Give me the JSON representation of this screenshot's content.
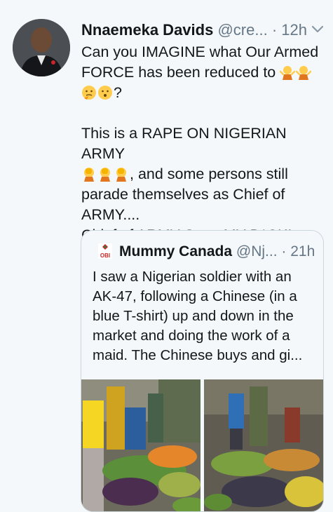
{
  "tweet": {
    "author_name": "Nnaemeka Davids",
    "handle": "@cre...",
    "separator": "·",
    "time": "12h",
    "lines": [
      "Can you IMAGINE what Our Armed",
      "FORCE has been reduced to",
      "?",
      "This is a RAPE ON NIGERIAN ARMY",
      ", and some persons still",
      "parade themselves as Chief of",
      "ARMY....",
      "Chief of ARMY Sta....MY D*CK!"
    ]
  },
  "quoted": {
    "author_name": "Mummy Canada",
    "handle": "@Nj...",
    "separator": "·",
    "time": "21h",
    "avatar_text": "OBI",
    "text": "I saw a Nigerian soldier with an AK-47, following a Chinese (in a blue T-shirt) up and down in the market and doing the work of a maid. The Chinese buys and gi..."
  },
  "colors": {
    "background": "#f5f8fa",
    "text": "#14171a",
    "secondary": "#657786",
    "border": "#ccd6dd",
    "emoji": "#ffcc4d",
    "emoji_shirt": "#e1761f"
  }
}
